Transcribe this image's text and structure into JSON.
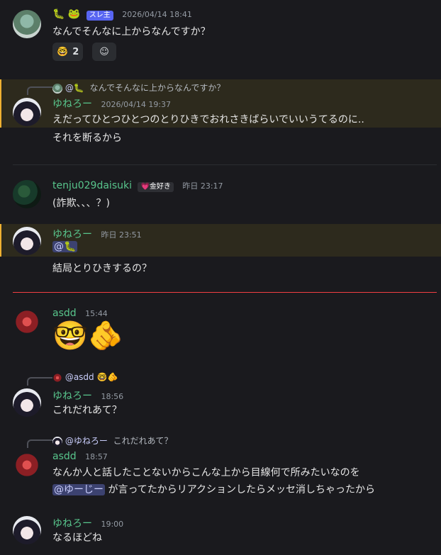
{
  "m1": {
    "name_emoji": "🐛",
    "name_emoji2": "🐸",
    "tag": "スレ主",
    "time": "2026/04/14 18:41",
    "text": "なんでそんなに上からなんですか？",
    "reaction_emoji": "🤓",
    "reaction_count": "2",
    "add_reaction": "☺"
  },
  "m2": {
    "reply_at": "@",
    "reply_name": "🐛",
    "reply_text": "なんでそんなに上からなんですか？",
    "name": "ゆねろー",
    "time": "2026/04/14 19:37",
    "line1": "えだってひとつひとつのとりひきでおれさきばらいでいいうてるのに..",
    "line2": "それを断るから"
  },
  "m3": {
    "name": "tenju029daisuki",
    "badge": "💗金好き",
    "time": "昨日 23:17",
    "text": "(詐欺、、、？)"
  },
  "m4": {
    "name": "ゆねろー",
    "time": "昨日 23:51",
    "mention": "@🐛",
    "text": "結局とりひきするの？"
  },
  "m5": {
    "name": "asdd",
    "time": "15:44",
    "emoji1": "🤓",
    "emoji2": "🫵"
  },
  "m6": {
    "reply_name": "@asdd",
    "reply_emoji": "🤓🫵",
    "name": "ゆねろー",
    "time": "18:56",
    "text": "これだれあて？"
  },
  "m7": {
    "reply_name": "@ゆねろー",
    "reply_text": "これだれあて？",
    "name": "asdd",
    "time": "18:57",
    "line1": "なんか人と話したことないからこんな上から目線何で所みたいなのを",
    "mention": "@ゆーじー",
    "line2": "が言ってたからリアクションしたらメッセ消しちゃったから"
  },
  "m8": {
    "name": "ゆねろー",
    "time": "19:00",
    "text": "なるほどね"
  },
  "colors": {
    "highlight": "#2d2a1d",
    "highlight_bar": "#f0b132",
    "name_green": "#58c58c",
    "new_divider": "#f23f43"
  }
}
